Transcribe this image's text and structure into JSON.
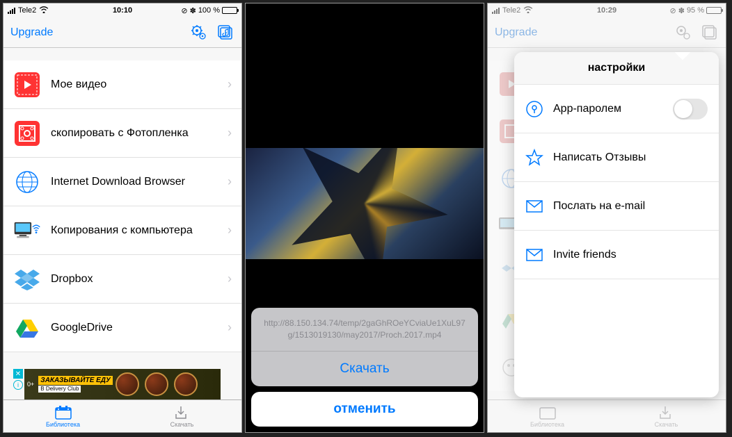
{
  "screen1": {
    "status": {
      "carrier": "Tele2",
      "time": "10:10",
      "bluetooth": "✽",
      "battery_text": "100 %",
      "rotation_lock": "⊘"
    },
    "header": {
      "upgrade": "Upgrade"
    },
    "rows": [
      {
        "label": "Мое видео"
      },
      {
        "label": "скопировать с Фотопленка"
      },
      {
        "label": "Internet Download Browser"
      },
      {
        "label": "Копирования с компьютера"
      },
      {
        "label": "Dropbox"
      },
      {
        "label": "GoogleDrive"
      }
    ],
    "ad": {
      "line1": "ЗАКАЗЫВАЙТЕ ЕДУ",
      "line2": "В Delivery Club",
      "plus": "0+"
    },
    "tabs": {
      "library": "Библиотека",
      "download": "Скачать"
    }
  },
  "screen2": {
    "sheet": {
      "url": "http://88.150.134.74/temp/2gaGhROeYCviaUe1XuL97g/1513019130/may2017/Proch.2017.mp4",
      "download": "Скачать",
      "cancel": "отменить"
    }
  },
  "screen3": {
    "status": {
      "carrier": "Tele2",
      "time": "10:29",
      "bluetooth": "✽",
      "battery_text": "95 %",
      "rotation_lock": "⊘"
    },
    "header": {
      "upgrade": "Upgrade"
    },
    "popover": {
      "title": "настройки",
      "rows": [
        {
          "label": "App-паролем",
          "toggle": false
        },
        {
          "label": "Написать Отзывы"
        },
        {
          "label": "Послать на e-mail"
        },
        {
          "label": "Invite friends"
        }
      ]
    },
    "tabs": {
      "library": "Библиотека",
      "download": "Скачать"
    }
  }
}
